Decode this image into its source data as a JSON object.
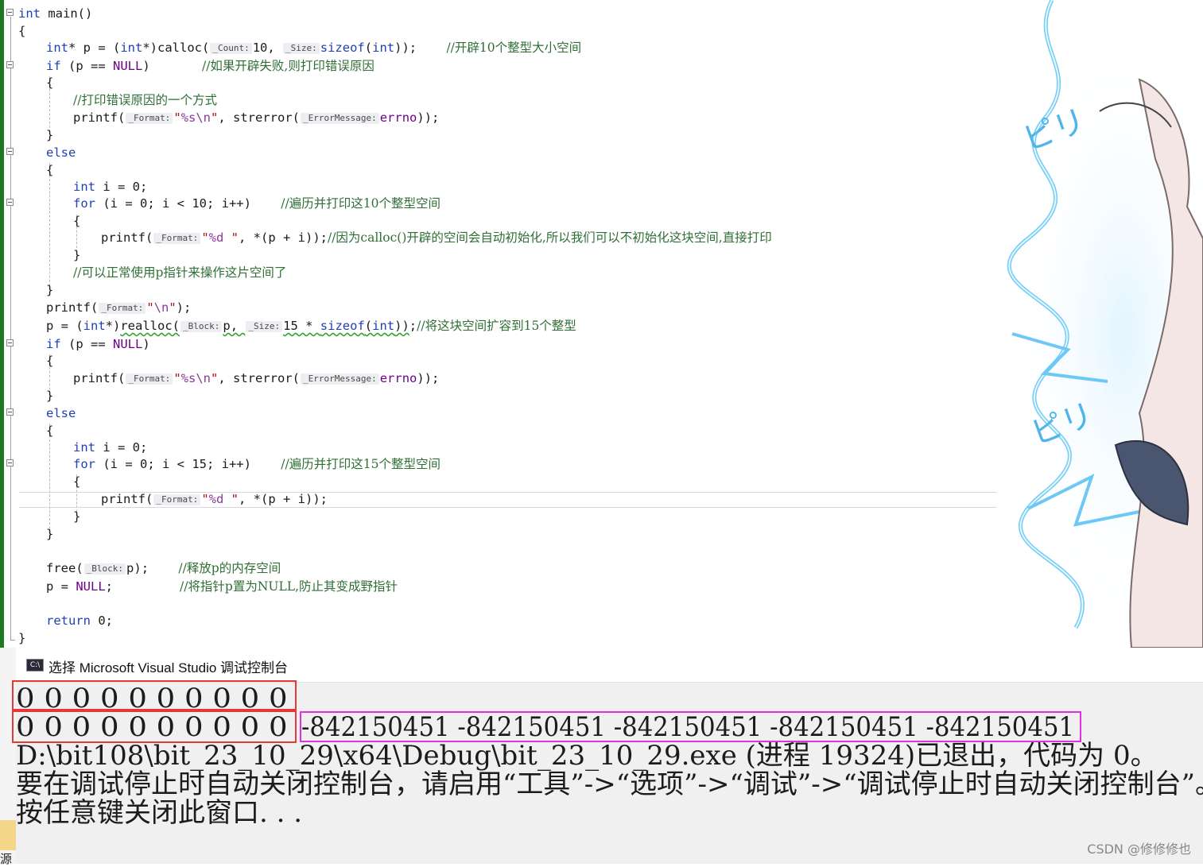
{
  "code_lines": [
    "int main()",
    "{",
    "int* p = (int*)calloc(_Count:10, _Size:sizeof(int));    //开辟10个整型大小空间",
    "if (p == NULL)       //如果开辟失败,则打印错误原因",
    "{",
    "//打印错误原因的一个方式",
    "printf(_Format:\"%s\\n\", strerror(_ErrorMessage:errno));",
    "}",
    "else",
    "{",
    "int i = 0;",
    "for (i = 0; i < 10; i++)    //遍历并打印这10个整型空间",
    "{",
    "printf(_Format:\"%d \", *(p + i));//因为calloc()开辟的空间会自动初始化,所以我们可以不初始化这块空间,直接打印",
    "}",
    "//可以正常使用p指针来操作这片空间了",
    "}",
    "printf(_Format:\"\\n\");",
    "p = (int*)realloc(_Block:p, _Size:15 * sizeof(int));//将这块空间扩容到15个整型",
    "if (p == NULL)",
    "{",
    "printf(_Format:\"%s\\n\", strerror(_ErrorMessage:errno));",
    "}",
    "else",
    "{",
    "int i = 0;",
    "for (i = 0; i < 15; i++)    //遍历并打印这15个整型空间",
    "{",
    "printf(_Format:\"%d \", *(p + i));",
    "}",
    "}",
    "free(_Block:p);    //释放p的内存空间",
    "p = NULL;         //将指针p置为NULL,防止其变成野指针",
    "return 0;",
    "}"
  ],
  "console": {
    "title": "选择 Microsoft Visual Studio 调试控制台",
    "icon_label": "C:\\",
    "line1": "0 0 0 0 0 0 0 0 0 0",
    "line2_zeros": "0 0 0 0 0 0 0 0 0 0",
    "line2_garbage": "-842150451 -842150451 -842150451 -842150451 -842150451",
    "line3": "D:\\bit108\\bit_23_10_29\\x64\\Debug\\bit_23_10_29.exe (进程 19324)已退出，代码为 0。",
    "line4": "要在调试停止时自动关闭控制台，请启用“工具”->“选项”->“调试”->“调试停止时自动关闭控制台”。",
    "line5": "按任意键关闭此窗口. . ."
  },
  "watermark": "CSDN @修修修也",
  "side_tab_label": "源",
  "colors": {
    "keyword": "#1f3fb5",
    "comment": "#2f6f36",
    "string": "#a31515",
    "highlight_red": "#e53935",
    "highlight_magenta": "#e030e0"
  }
}
